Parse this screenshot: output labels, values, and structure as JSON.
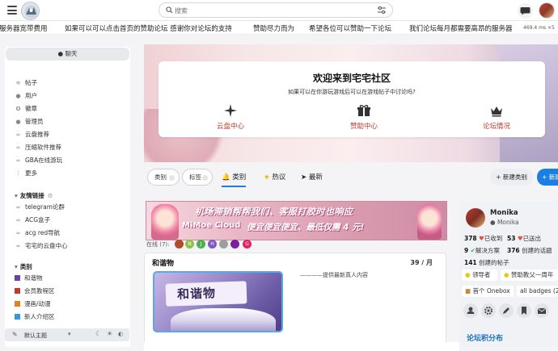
{
  "header": {
    "search_placeholder": "搜索"
  },
  "marquee": {
    "items": [
      "服务器宽带费用",
      "如果可以可以点击首页的赞助论坛 感谢你对论坛的支持",
      "赞助尽力而为",
      "希望各位可以赞助一下论坛",
      "我们论坛每月都需要高昂的服务器"
    ],
    "size_label": "469.4 ms ×5"
  },
  "sidebar": {
    "chat_tab": "聊天",
    "nav": [
      "帖子",
      "用户",
      "徽章",
      "管理员",
      "云盘推荐",
      "压缩软件推荐",
      "GBA在线游玩",
      "更多"
    ],
    "links_heading": "友情链接",
    "links": [
      "telegram论群",
      "ACG盒子",
      "acg red导航",
      "宅宅的云盘中心"
    ],
    "categories_heading": "类别",
    "categories": [
      {
        "label": "和谐物",
        "color": "#6d3fa8"
      },
      {
        "label": "会员教程区",
        "color": "#c0392b"
      },
      {
        "label": "漫画/动漫",
        "color": "#e67e22"
      },
      {
        "label": "新人介绍区",
        "color": "#3498db"
      }
    ],
    "footer_theme": "默认主题"
  },
  "welcome": {
    "title": "欢迎来到宅宅社区",
    "subtitle": "如果可以在你游玩游戏后可以在游戏帖子中讨论吗?",
    "links": [
      "云盘中心",
      "赞助中心",
      "论坛情况"
    ]
  },
  "filters": {
    "category": "类别",
    "tags": "标签",
    "tabs": [
      "类别",
      "热议",
      "最新"
    ],
    "new_category": "新建类别",
    "new_topic": "新建"
  },
  "ad": {
    "line1": "机场滞销帮帮我们、客服打胶时也响应",
    "line2": "MiMoe Cloud",
    "line3": "便宜便宜便宜、最低仅需 4 元!"
  },
  "online": {
    "label": "在线 (7):",
    "users": [
      {
        "initial": "",
        "color": "#b34a2a"
      },
      {
        "initial": "N",
        "color": "#8bc34a"
      },
      {
        "initial": "J",
        "color": "#4caf50"
      },
      {
        "initial": "H",
        "color": "#7e57c2"
      },
      {
        "initial": "",
        "color": "#9e9e9e"
      },
      {
        "initial": "",
        "color": "#7b1fa2"
      },
      {
        "initial": "G",
        "color": "#e91e63"
      }
    ]
  },
  "category_card": {
    "title": "和谐物",
    "count": "39 / 月",
    "thumb_text": "和谐物",
    "description": "————提供最新真人内容"
  },
  "profile": {
    "name": "Monika",
    "username": "Monika",
    "stats": [
      {
        "value": "378",
        "label": "已收到"
      },
      {
        "value": "53",
        "label": "已送出"
      },
      {
        "value": "9",
        "label": "解决方案"
      },
      {
        "value": "376",
        "label": "创建的话题"
      },
      {
        "value": "141",
        "label": "创建的帖子"
      }
    ],
    "badges": [
      "领导者",
      "赞助教父一周年",
      "首个 Onebox",
      "all badges (2"
    ],
    "distribution": "论坛积分布"
  }
}
